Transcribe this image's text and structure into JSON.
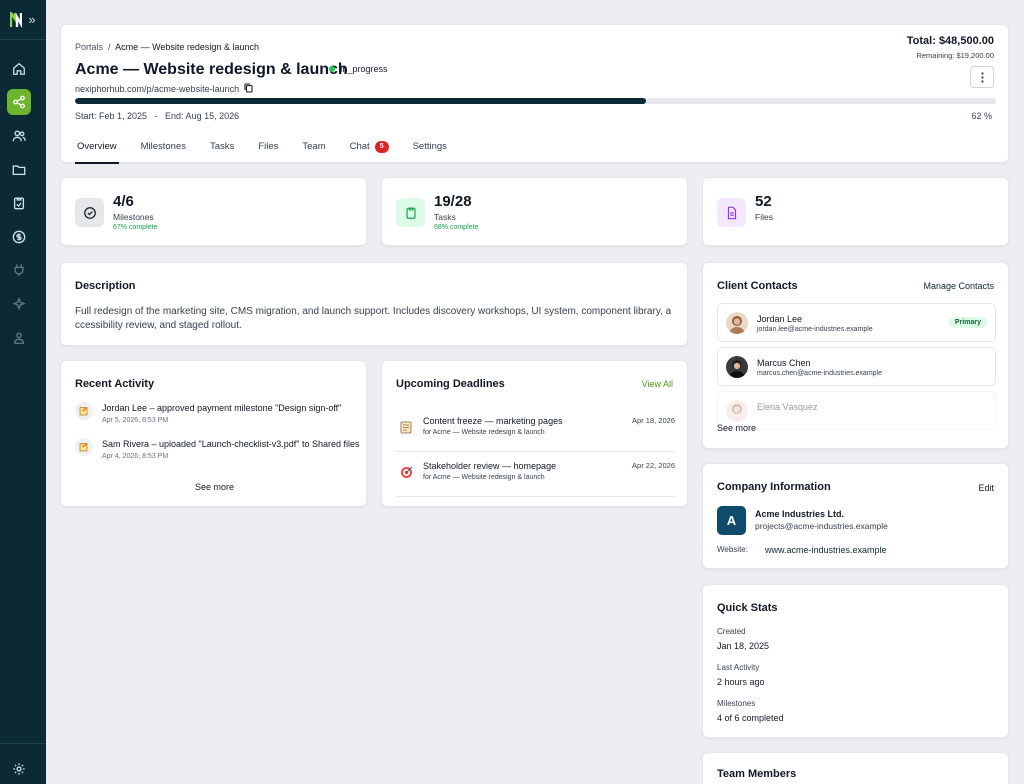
{
  "sidebar": {
    "items": [
      {
        "name": "home-icon"
      },
      {
        "name": "share-nodes-icon"
      },
      {
        "name": "users-icon"
      },
      {
        "name": "folder-icon"
      },
      {
        "name": "clipboard-icon"
      },
      {
        "name": "dollar-icon"
      },
      {
        "name": "plug-icon"
      },
      {
        "name": "sparkle-icon"
      },
      {
        "name": "user-group-icon"
      },
      {
        "name": "settings-icon"
      }
    ],
    "active_color": "#6cb52d",
    "bg_color": "#0b2a36"
  },
  "header": {
    "breadcrumb_root": "Portals",
    "breadcrumb_sep": "/",
    "breadcrumb_current": "Acme — Website redesign & launch",
    "title": "Acme — Website redesign & launch",
    "status": "In_progress",
    "url": "nexiphorhub.com/p/acme-website-launch",
    "total": "Total: $48,500.00",
    "remaining": "Remaining: $19,200.00",
    "progress": 0.62,
    "progress_label": "62 %",
    "dates": "Start: Feb 1, 2025   -   End: Aug 15, 2026"
  },
  "tabs": [
    {
      "label": "Overview"
    },
    {
      "label": "Milestones"
    },
    {
      "label": "Tasks"
    },
    {
      "label": "Files"
    },
    {
      "label": "Team"
    },
    {
      "label": "Chat",
      "badge": "5"
    },
    {
      "label": "Settings"
    }
  ],
  "stats": [
    {
      "value": "4/6",
      "label": "Milestones",
      "sub": "67% complete",
      "icon": "check-circle-icon",
      "bg": "#e5e7eb"
    },
    {
      "value": "19/28",
      "label": "Tasks",
      "sub": "68% complete",
      "icon": "clipboard-icon",
      "bg": "#dcfce7"
    },
    {
      "value": "52",
      "label": "Files",
      "sub": "",
      "icon": "file-icon",
      "bg": "#f3e8ff"
    }
  ],
  "description": {
    "title": "Description",
    "text": "Full redesign of the marketing site, CMS migration, and launch support. Includes discovery workshops, UI system, component library, accessibility review, and staged rollout."
  },
  "activity": {
    "title": "Recent Activity",
    "items": [
      {
        "text": "Jordan Lee – approved payment milestone \"Design sign-off\"",
        "time": "Apr 5, 2026, 8:53 PM"
      },
      {
        "text": "Sam Rivera – uploaded \"Launch-checklist-v3.pdf\" to Shared files",
        "time": "Apr 4, 2026, 8:53 PM"
      }
    ],
    "see_more": "See more"
  },
  "deadlines": {
    "title": "Upcoming Deadlines",
    "view_all": "View All",
    "items": [
      {
        "title": "Content freeze — marketing pages",
        "sub": "for Acme — Website redesign & launch",
        "date": "Apr 18, 2026",
        "icon": "notepad-icon"
      },
      {
        "title": "Stakeholder review — homepage",
        "sub": "for Acme — Website redesign & launch",
        "date": "Apr 22, 2026",
        "icon": "target-icon"
      }
    ]
  },
  "contacts": {
    "title": "Client Contacts",
    "manage": "Manage Contacts",
    "items": [
      {
        "name": "Jordan Lee",
        "email": "jordan.lee@acme-industries.example",
        "badge": "Primary"
      },
      {
        "name": "Marcus Chen",
        "email": "marcus.chen@acme-industries.example",
        "badge": ""
      },
      {
        "name": "Elena Vásquez",
        "email": "",
        "badge": ""
      }
    ],
    "see_more": "See more"
  },
  "company": {
    "title": "Company Information",
    "edit": "Edit",
    "logo_letter": "A",
    "name": "Acme Industries Ltd.",
    "email": "projects@acme-industries.example",
    "website_label": "Website:",
    "website": "www.acme-industries.example"
  },
  "quick_stats": {
    "title": "Quick Stats",
    "items": [
      {
        "label": "Created",
        "value": "Jan 18, 2025"
      },
      {
        "label": "Last Activity",
        "value": "2 hours ago"
      },
      {
        "label": "Milestones",
        "value": "4 of 6 completed"
      }
    ]
  },
  "team": {
    "title": "Team Members"
  }
}
